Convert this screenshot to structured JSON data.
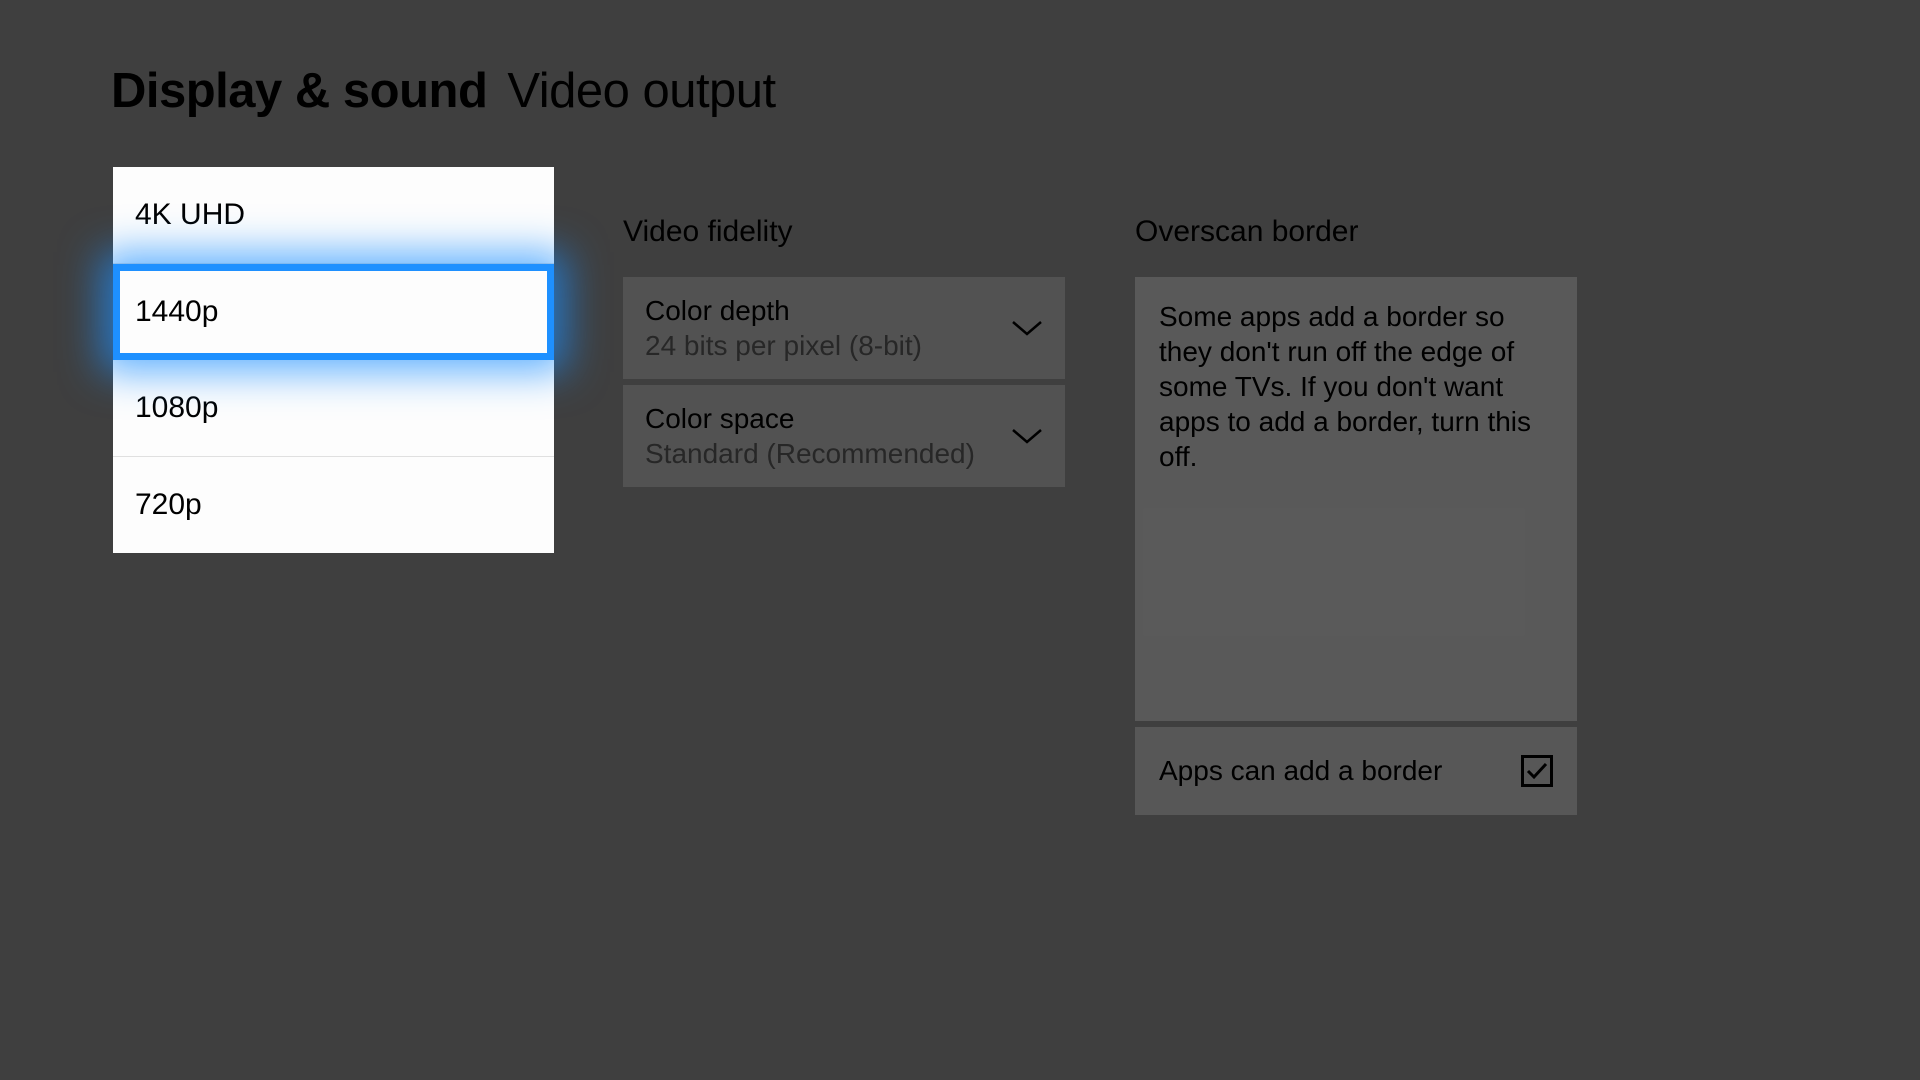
{
  "header": {
    "title": "Display & sound",
    "subtitle": "Video output"
  },
  "resolution_options": [
    {
      "label": "4K UHD",
      "selected": false
    },
    {
      "label": "1440p",
      "selected": true
    },
    {
      "label": "1080p",
      "selected": false
    },
    {
      "label": "720p",
      "selected": false
    }
  ],
  "video_fidelity": {
    "section_title": "Video fidelity",
    "color_depth": {
      "label": "Color depth",
      "value": "24 bits per pixel (8-bit)"
    },
    "color_space": {
      "label": "Color space",
      "value": "Standard (Recommended)"
    }
  },
  "overscan": {
    "section_title": "Overscan border",
    "description": "Some apps add a border so they don't run off the edge of some TVs. If you don't want apps to add a border, turn this off.",
    "checkbox_label": "Apps can add a border",
    "checked": true
  }
}
